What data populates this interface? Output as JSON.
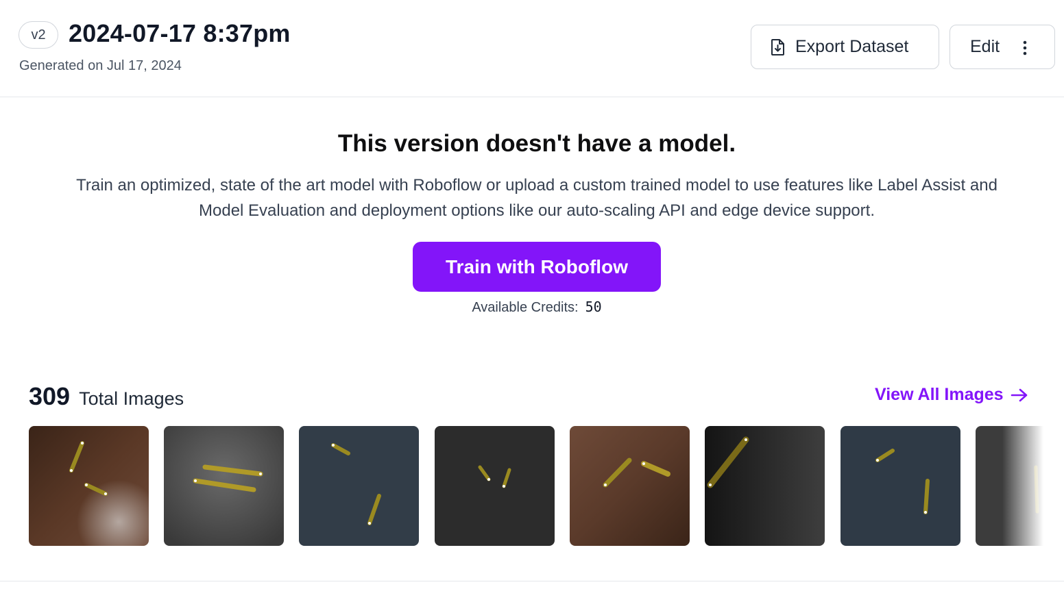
{
  "header": {
    "version_badge": "v2",
    "title": "2024-07-17 8:37pm",
    "generated": "Generated on Jul 17, 2024",
    "export_label": "Export Dataset",
    "edit_label": "Edit",
    "export_icon": "file-download-icon",
    "more_icon": "vertical-dots-icon"
  },
  "empty_state": {
    "title": "This version doesn't have a model.",
    "description": "Train an optimized, state of the art model with Roboflow or upload a custom trained model to use features like Label Assist and Model Evaluation and deployment options like our auto-scaling API and edge device support.",
    "train_label": "Train with Roboflow",
    "credits_label": "Available Credits:",
    "credits_value": "50",
    "accent_color": "#8315f9"
  },
  "images": {
    "count": "309",
    "label": "Total Images",
    "view_all": "View All Images",
    "view_all_icon": "arrow-right-icon",
    "thumbnails": [
      {
        "name": "thumbnail-1",
        "background": "wood"
      },
      {
        "name": "thumbnail-2",
        "background": "gray"
      },
      {
        "name": "thumbnail-3",
        "background": "slate"
      },
      {
        "name": "thumbnail-4",
        "background": "asphalt"
      },
      {
        "name": "thumbnail-5",
        "background": "wood"
      },
      {
        "name": "thumbnail-6",
        "background": "dark-gray"
      },
      {
        "name": "thumbnail-7",
        "background": "slate"
      },
      {
        "name": "thumbnail-8",
        "background": "asphalt"
      }
    ]
  }
}
